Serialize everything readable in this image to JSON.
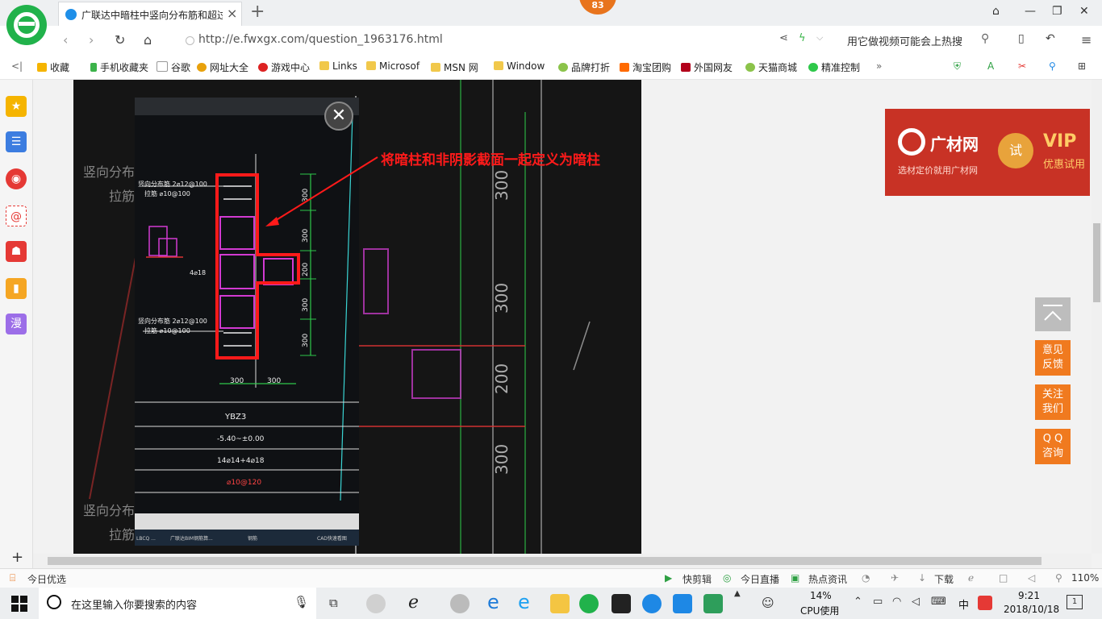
{
  "browser": {
    "tab_title": "广联达中暗柱中竖向分布筋和超过",
    "badge_count": "83",
    "url": "http://e.fwxgx.com/question_1963176.html",
    "search_hint": "用它做视频可能会上热搜"
  },
  "bookmarks": [
    "收藏",
    "手机收藏夹",
    "谷歌",
    "网址大全",
    "游戏中心",
    "Links",
    "Microsof",
    "MSN 网",
    "Window",
    "品牌打折",
    "淘宝团购",
    "外国网友",
    "天猫商城",
    "精准控制"
  ],
  "sidebar": {
    "items": [
      "star",
      "news",
      "weibo",
      "mail",
      "game",
      "bookmark",
      "漫"
    ]
  },
  "content": {
    "annotation": "将暗柱和非阴影截面一起定义为暗柱",
    "drawing": {
      "label_top1": "竖向分布筋 2⌀12@100",
      "label_top2": "拉筋 ⌀10@100",
      "label_bot1": "竖向分布筋 2⌀12@100",
      "label_bot2": "拉筋 ⌀10@100",
      "label_mid": "4⌀18",
      "dim_300": "300",
      "dim_200": "200",
      "table_name": "YBZ3",
      "table_elev": "-5.40~±0.00",
      "table_bars": "14⌀14+4⌀18",
      "table_stirrup": "⌀10@120",
      "bg_dims": [
        "300",
        "300",
        "200",
        "300"
      ],
      "bg_label1": "竖向分布",
      "bg_label2": "拉筋",
      "viewer_taskbar": [
        "LBCQ ...",
        "广联达BIM钢筋算...",
        "钢筋",
        "CAD快速看图"
      ]
    },
    "ad": {
      "brand": "广材网",
      "sub": "选材定价就用广材网",
      "trial": "试",
      "vip": "VIP",
      "vip_sub": "优惠试用"
    },
    "float_buttons": [
      "意见\n反馈",
      "关注\n我们",
      "Q Q\n咨询"
    ]
  },
  "statusbar": {
    "left": "今日优选",
    "items": [
      "快剪辑",
      "今日直播",
      "热点资讯",
      "下载"
    ],
    "zoom": "110%"
  },
  "taskbar": {
    "search_placeholder": "在这里输入你要搜索的内容",
    "cpu_percent": "14%",
    "cpu_label": "CPU使用",
    "ime": "中",
    "time": "9:21",
    "date": "2018/10/18",
    "notifications": "1"
  },
  "colors": {
    "accent_green": "#21b24b",
    "orange": "#f07a1f",
    "annotation_red": "#ff1a1a",
    "cad_magenta": "#d23ad2",
    "cad_green": "#2ec84a"
  }
}
